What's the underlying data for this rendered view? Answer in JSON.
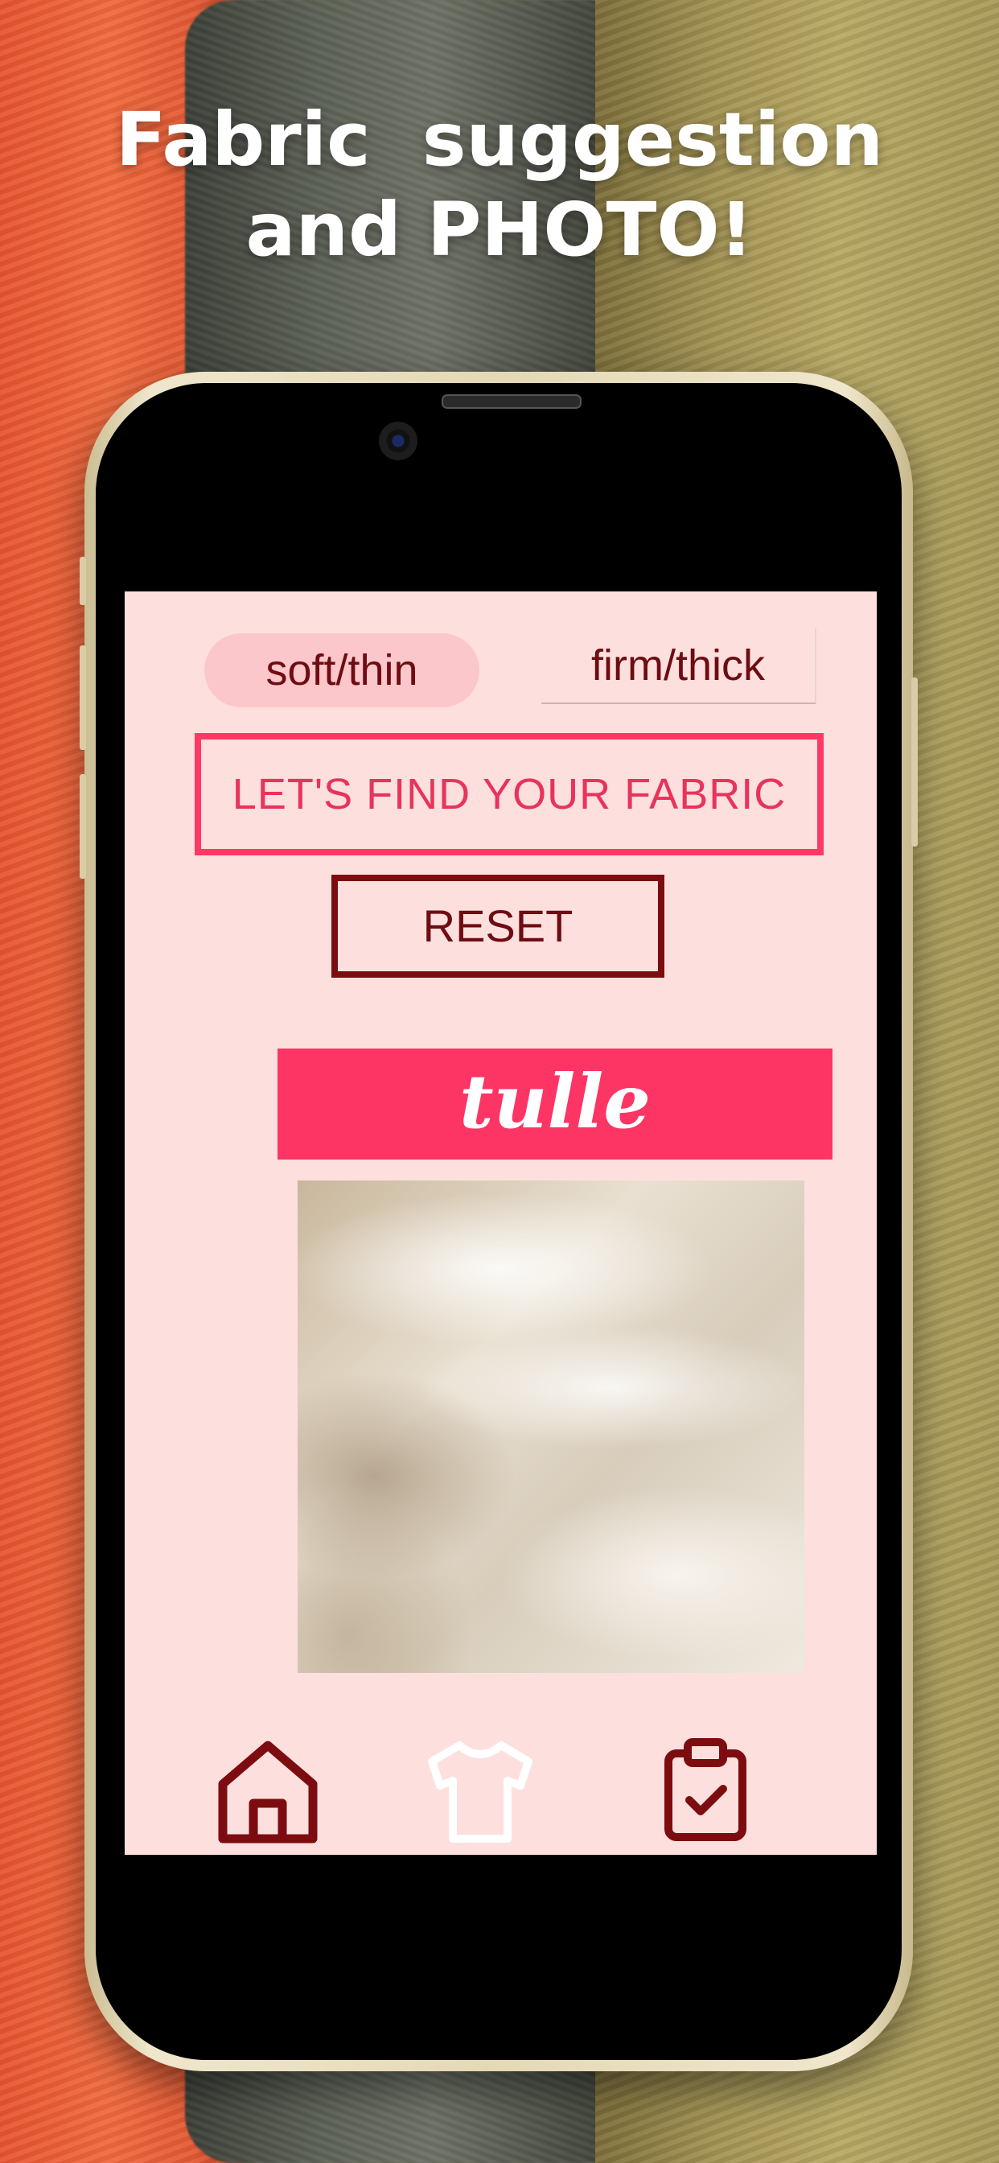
{
  "headline": {
    "line1": "Fabric  suggestion",
    "line2": "and PHOTO!"
  },
  "app": {
    "tabs": {
      "soft_label": "soft/thin",
      "firm_label": "firm/thick",
      "selected": "soft/thin"
    },
    "find_button_label": "LET'S FIND YOUR FABRIC",
    "reset_button_label": "RESET",
    "result": {
      "fabric_name": "tulle",
      "photo_icon": "fabric-photo"
    },
    "bottom_nav": [
      {
        "icon": "home-icon",
        "active": false
      },
      {
        "icon": "shirt-icon",
        "active": true
      },
      {
        "icon": "clipboard-check-icon",
        "active": false
      }
    ]
  },
  "colors": {
    "screen_background": "#fde0de",
    "accent_pink": "#fc3564",
    "dark_red": "#7c0c10",
    "selected_tab": "#fcc7ca"
  }
}
